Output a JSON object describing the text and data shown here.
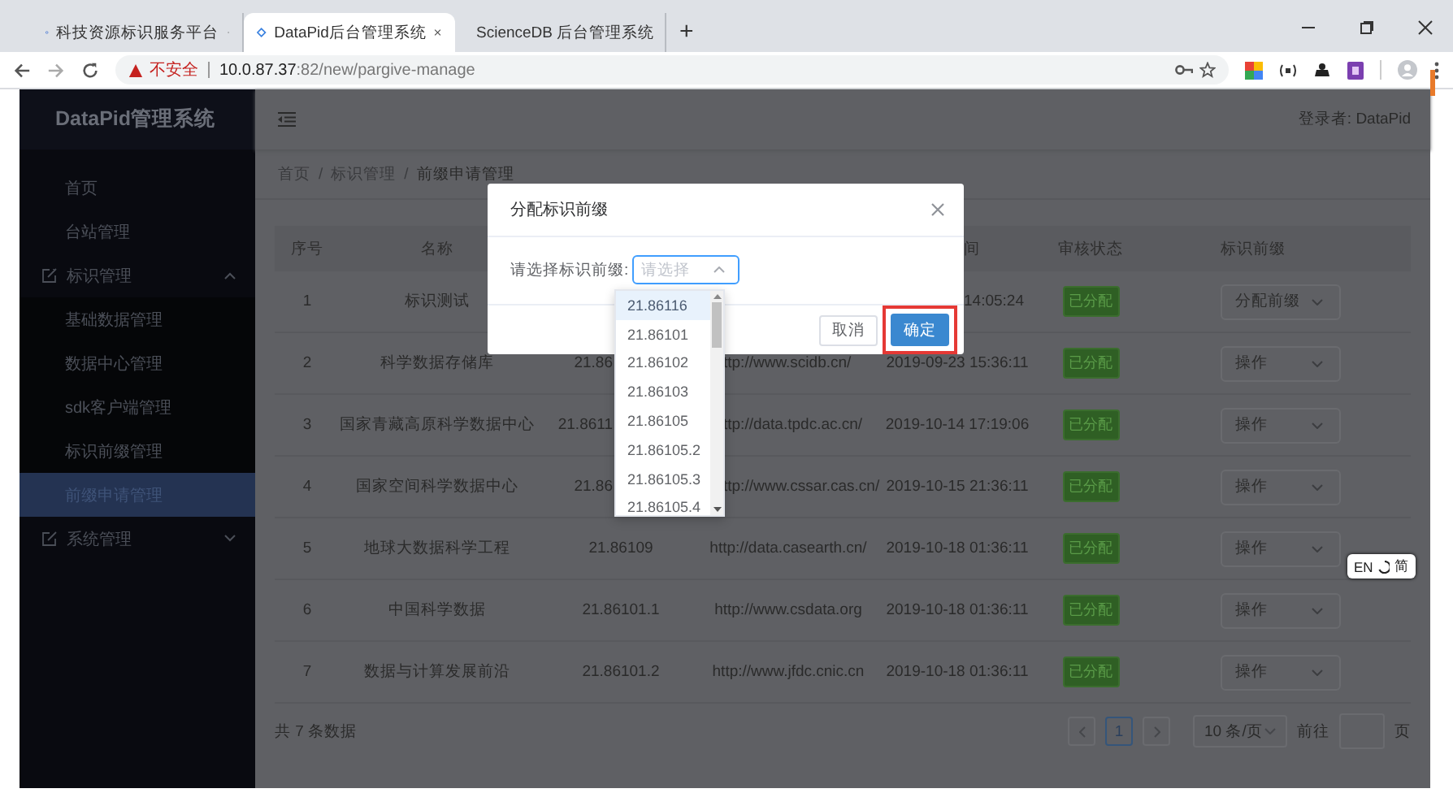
{
  "browser": {
    "tabs": [
      {
        "title": "科技资源标识服务平台",
        "selected": false
      },
      {
        "title": "DataPid后台管理系统",
        "selected": true
      },
      {
        "title": "ScienceDB 后台管理系统",
        "selected": false
      }
    ],
    "new_tab": "+",
    "address": {
      "security": "不安全",
      "host": "10.0.87.37",
      "rest": ":82/new/pargive-manage"
    }
  },
  "sidebar": {
    "title": "DataPid管理系统",
    "items": [
      {
        "label": "首页",
        "selected": false
      },
      {
        "label": "台站管理",
        "selected": false
      },
      {
        "label": "标识管理",
        "expanded": true,
        "children": [
          {
            "label": "基础数据管理",
            "selected": false
          },
          {
            "label": "数据中心管理",
            "selected": false
          },
          {
            "label": "sdk客户端管理",
            "selected": false
          },
          {
            "label": "标识前缀管理",
            "selected": false
          },
          {
            "label": "前缀申请管理",
            "selected": true
          }
        ]
      },
      {
        "label": "系统管理",
        "expanded": false
      }
    ]
  },
  "header": {
    "user": "登录者: DataPid"
  },
  "breadcrumb": {
    "separator": "/",
    "items": [
      "首页",
      "标识管理",
      "前缀申请管理"
    ]
  },
  "table": {
    "columns": [
      {
        "label": "序号"
      },
      {
        "label": "名称"
      },
      {},
      {},
      {
        "label": "间",
        "partial": true
      },
      {
        "label": "审核状态"
      },
      {
        "label": "标识前缀"
      }
    ],
    "rows": [
      {
        "no": "1",
        "name": "标识测试",
        "time": {
          "text": "14:05:24",
          "partial": true
        },
        "status": "已分配",
        "action": "分配前缀"
      },
      {
        "no": "2",
        "name": "科学数据存储库",
        "prefix": {
          "text": "21.86",
          "partial": true
        },
        "url": {
          "text": "ttp://www.scidb.cn/",
          "partial": true
        },
        "time": "2019-09-23 15:36:11",
        "status": "已分配",
        "action": "操作"
      },
      {
        "no": "3",
        "name": "国家青藏高原科学数据中心",
        "prefix": {
          "text": "21.8611",
          "partial": true
        },
        "url": {
          "text": "ttp://data.tpdc.ac.cn/",
          "partial": true
        },
        "time": "2019-10-14 17:19:06",
        "status": "已分配",
        "action": "操作"
      },
      {
        "no": "4",
        "name": "国家空间科学数据中心",
        "prefix": {
          "text": "21.86",
          "partial": true
        },
        "url": {
          "text": "ttp://www.cssar.cas.cn/",
          "partial": true
        },
        "time": "2019-10-15 21:36:11",
        "status": "已分配",
        "action": "操作"
      },
      {
        "no": "5",
        "name": "地球大数据科学工程",
        "prefix": "21.86109",
        "url": "http://data.casearth.cn/",
        "time": "2019-10-18 01:36:11",
        "status": "已分配",
        "action": "操作"
      },
      {
        "no": "6",
        "name": "中国科学数据",
        "prefix": "21.86101.1",
        "url": "http://www.csdata.org",
        "time": "2019-10-18 01:36:11",
        "status": "已分配",
        "action": "操作"
      },
      {
        "no": "7",
        "name": "数据与计算发展前沿",
        "prefix": "21.86101.2",
        "url": "http://www.jfdc.cnic.cn",
        "time": "2019-10-18 01:36:11",
        "status": "已分配",
        "action": "操作"
      }
    ]
  },
  "pagination": {
    "total": "共 7 条数据",
    "pages": [
      {
        "label": "1",
        "selected": true
      }
    ],
    "page_size": "10 条/页",
    "goto": "前往",
    "goto_suffix": "页"
  },
  "dialog": {
    "title": "分配标识前缀",
    "field_label": "请选择标识前缀:",
    "placeholder": "请选择",
    "cancel": "取消",
    "confirm": "确定",
    "highlighted": true,
    "options": [
      {
        "label": "21.86116",
        "selected": true
      },
      {
        "label": "21.86101",
        "selected": false
      },
      {
        "label": "21.86102",
        "selected": false
      },
      {
        "label": "21.86103",
        "selected": false
      },
      {
        "label": "21.86105",
        "selected": false
      },
      {
        "label": "21.86105.2",
        "selected": false
      },
      {
        "label": "21.86105.3",
        "selected": false
      },
      {
        "label": "21.86105.4",
        "selected": false
      }
    ]
  },
  "ime_badge": {
    "left": "EN",
    "right": "简"
  }
}
